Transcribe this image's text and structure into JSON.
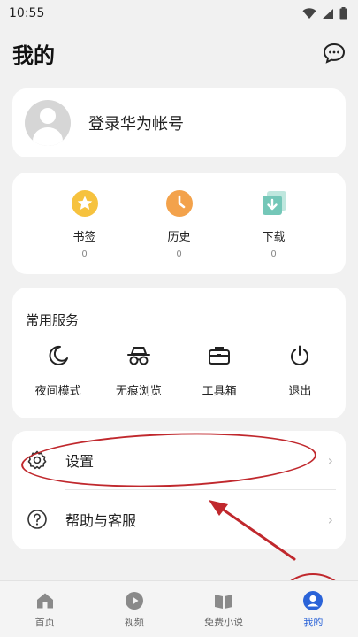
{
  "status_bar": {
    "time": "10:55",
    "icons": [
      "wifi-icon",
      "signal-icon",
      "battery-icon"
    ]
  },
  "header": {
    "title": "我的",
    "message_icon": "chat-bubble-icon"
  },
  "account": {
    "login_text": "登录华为帐号"
  },
  "quick_actions": [
    {
      "label": "书签",
      "count": "0",
      "icon": "star-icon",
      "color": "#f6c23e"
    },
    {
      "label": "历史",
      "count": "0",
      "icon": "clock-icon",
      "color": "#f3a24b"
    },
    {
      "label": "下载",
      "count": "0",
      "icon": "download-icon",
      "color": "#74c7b8"
    }
  ],
  "services": {
    "title": "常用服务",
    "items": [
      {
        "label": "夜间模式",
        "icon": "moon-icon"
      },
      {
        "label": "无痕浏览",
        "icon": "incognito-icon"
      },
      {
        "label": "工具箱",
        "icon": "toolbox-icon"
      },
      {
        "label": "退出",
        "icon": "power-icon"
      }
    ]
  },
  "settings_list": [
    {
      "label": "设置",
      "icon": "gear-icon"
    },
    {
      "label": "帮助与客服",
      "icon": "help-icon"
    }
  ],
  "tabbar": {
    "items": [
      {
        "label": "首页",
        "icon": "home-icon"
      },
      {
        "label": "视频",
        "icon": "video-icon"
      },
      {
        "label": "免费小说",
        "icon": "book-icon"
      },
      {
        "label": "我的",
        "icon": "profile-icon"
      }
    ],
    "active_color": "#2a63d8"
  },
  "annotation_color": "#c0282d"
}
